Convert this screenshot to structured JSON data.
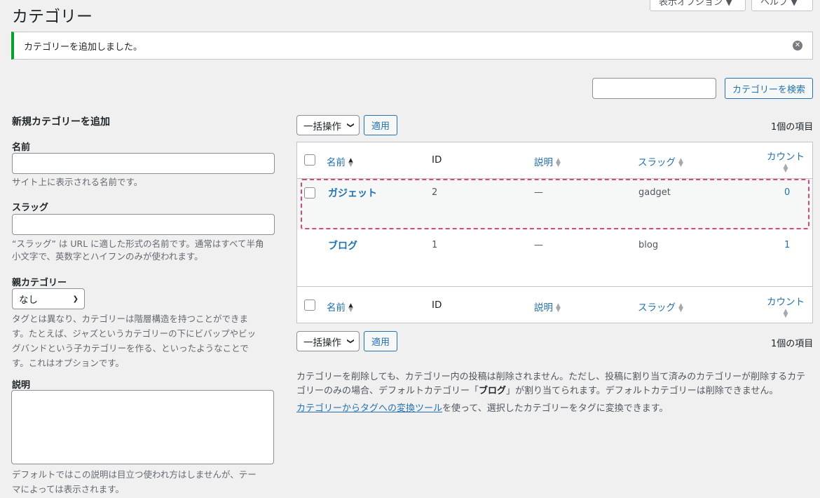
{
  "page": {
    "title": "カテゴリー"
  },
  "top_buttons": {
    "screen_options": "表示オプション ▼",
    "help": "ヘルプ ▼"
  },
  "notice": {
    "text": "カテゴリーを追加しました。",
    "dismiss_icon": "dismiss-icon"
  },
  "search": {
    "value": "",
    "button_label": "カテゴリーを検索"
  },
  "form": {
    "title": "新規カテゴリーを追加",
    "name_label": "名前",
    "name_value": "",
    "name_help": "サイト上に表示される名前です。",
    "slug_label": "スラッグ",
    "slug_value": "",
    "slug_help_1": "“スラッグ” は URL に適した形式の名前です。通常はすべて半角",
    "slug_help_2": "小文字で、英数字とハイフンのみが使われます。",
    "parent_label": "親カテゴリー",
    "parent_selected": "なし",
    "parent_help_1": "タグとは異なり、カテゴリーは階層構造を持つことができま",
    "parent_help_2": "す。たとえば、ジャズというカテゴリーの下にビバップやビッ",
    "parent_help_3": "グバンドという子カテゴリーを作る、といったようなことで",
    "parent_help_4": "す。これはオプションです。",
    "desc_label": "説明",
    "desc_value": "",
    "desc_help_1": "デフォルトではこの説明は目立つ使われ方はしませんが、テー",
    "desc_help_2": "マによっては表示されます。"
  },
  "list": {
    "bulk_action": "一括操作",
    "apply": "適用",
    "item_count": "1個の項目",
    "columns": {
      "name": "名前",
      "id": "ID",
      "description": "説明",
      "slug": "スラッグ",
      "count": "カウント"
    },
    "rows": [
      {
        "name": "ガジェット",
        "id": "2",
        "description": "—",
        "slug": "gadget",
        "count": "0"
      },
      {
        "name": "ブログ",
        "id": "1",
        "description": "—",
        "slug": "blog",
        "count": "1"
      }
    ]
  },
  "footer": {
    "note_1": "カテゴリーを削除しても、カテゴリー内の投稿は削除されません。ただし、投稿に割り当て済みのカテゴリーが削除するカテ",
    "note_2a": "ゴリーのみの場合、デフォルトカテゴリー「",
    "note_2b": "ブログ",
    "note_2c": "」が割り当てられます。デフォルトカテゴリーは削除できません。",
    "link": "カテゴリーからタグへの変換ツール",
    "link_suffix": "を使って、選択したカテゴリーをタグに変換できます。"
  },
  "colors": {
    "accent": "#2271b1",
    "success": "#00a32a",
    "highlight": "#e0447a"
  }
}
